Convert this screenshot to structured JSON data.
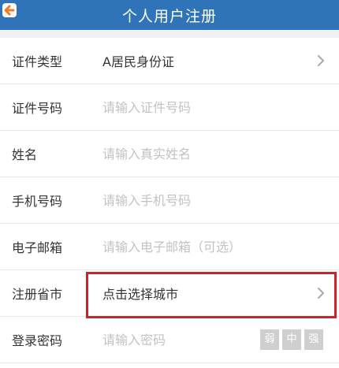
{
  "header": {
    "title": "个人用户注册"
  },
  "form": {
    "rows": [
      {
        "label": "证件类型",
        "value": "A居民身份证",
        "type": "select"
      },
      {
        "label": "证件号码",
        "placeholder": "请输入证件号码",
        "type": "input"
      },
      {
        "label": "姓名",
        "placeholder": "请输入真实姓名",
        "type": "input"
      },
      {
        "label": "手机号码",
        "placeholder": "请输入手机号码",
        "type": "input"
      },
      {
        "label": "电子邮箱",
        "placeholder": "请输入电子邮箱（可选）",
        "type": "input"
      },
      {
        "label": "注册省市",
        "value": "点击选择城市",
        "type": "select"
      },
      {
        "label": "登录密码",
        "placeholder": "请输入密码",
        "type": "password"
      }
    ]
  },
  "password_strength": [
    "弱",
    "中",
    "强"
  ],
  "colors": {
    "header": "#2f73b9",
    "highlight": "#c9232c"
  }
}
